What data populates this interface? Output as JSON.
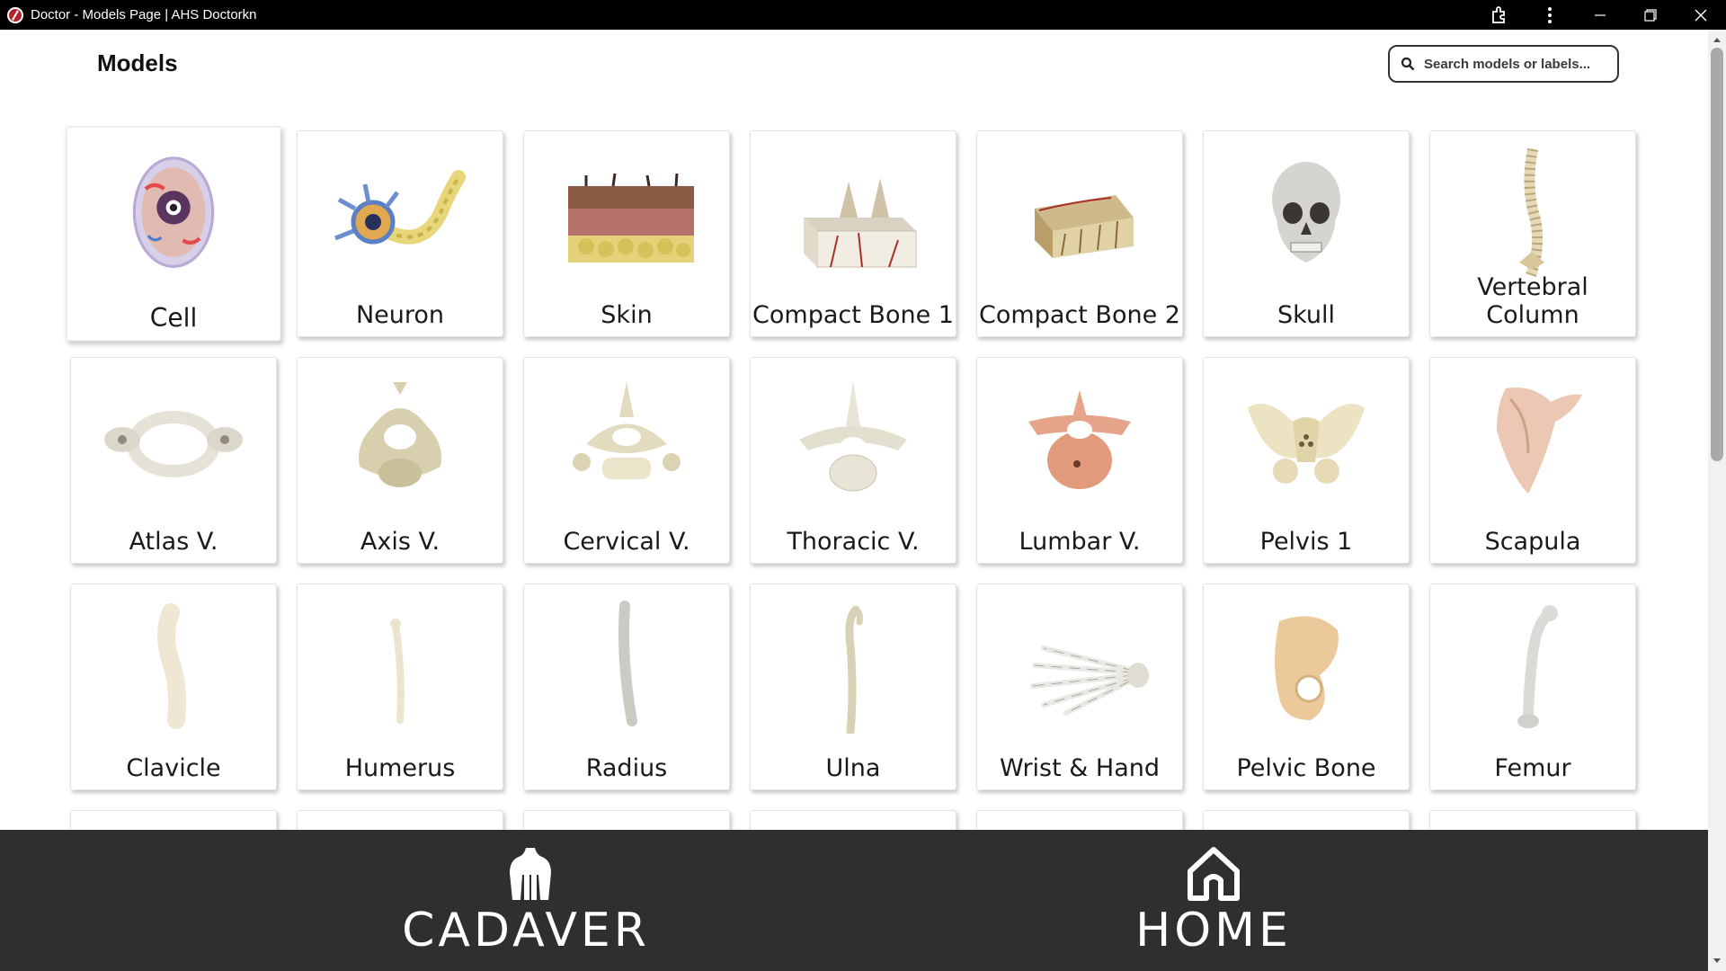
{
  "window": {
    "title": "Doctor - Models Page | AHS Doctorkn",
    "icons": [
      "app-logo-icon",
      "extension-icon",
      "more-vertical-icon",
      "minimize-icon",
      "restore-icon",
      "close-icon"
    ]
  },
  "page": {
    "title": "Models"
  },
  "search": {
    "placeholder": "Search models or labels..."
  },
  "models": [
    {
      "label": "Cell",
      "icon": "cell-model"
    },
    {
      "label": "Neuron",
      "icon": "neuron-model"
    },
    {
      "label": "Skin",
      "icon": "skin-model"
    },
    {
      "label": "Compact Bone 1",
      "icon": "compact-bone-model"
    },
    {
      "label": "Compact Bone 2",
      "icon": "compact-bone-model"
    },
    {
      "label": "Skull",
      "icon": "skull-model"
    },
    {
      "label": "Vertebral Column",
      "icon": "vertebral-column-model"
    },
    {
      "label": "Atlas V.",
      "icon": "atlas-vertebra-model"
    },
    {
      "label": "Axis V.",
      "icon": "axis-vertebra-model"
    },
    {
      "label": "Cervical V.",
      "icon": "cervical-vertebra-model"
    },
    {
      "label": "Thoracic V.",
      "icon": "thoracic-vertebra-model"
    },
    {
      "label": "Lumbar V.",
      "icon": "lumbar-vertebra-model"
    },
    {
      "label": "Pelvis 1",
      "icon": "pelvis-model"
    },
    {
      "label": "Scapula",
      "icon": "scapula-model"
    },
    {
      "label": "Clavicle",
      "icon": "clavicle-model"
    },
    {
      "label": "Humerus",
      "icon": "humerus-model"
    },
    {
      "label": "Radius",
      "icon": "radius-model"
    },
    {
      "label": "Ulna",
      "icon": "ulna-model"
    },
    {
      "label": "Wrist & Hand",
      "icon": "hand-model"
    },
    {
      "label": "Pelvic Bone",
      "icon": "pelvic-bone-model"
    },
    {
      "label": "Femur",
      "icon": "femur-model"
    }
  ],
  "bottom_nav": {
    "cadaver": {
      "label": "CADAVER",
      "icon": "torso-icon"
    },
    "home": {
      "label": "HOME",
      "icon": "home-icon"
    }
  },
  "colors": {
    "titlebar": "#000000",
    "bottombar": "#2f2f2f",
    "card_border": "#e3e3e3",
    "bone": "#e8e0cc",
    "muscle": "#e2a58c"
  }
}
